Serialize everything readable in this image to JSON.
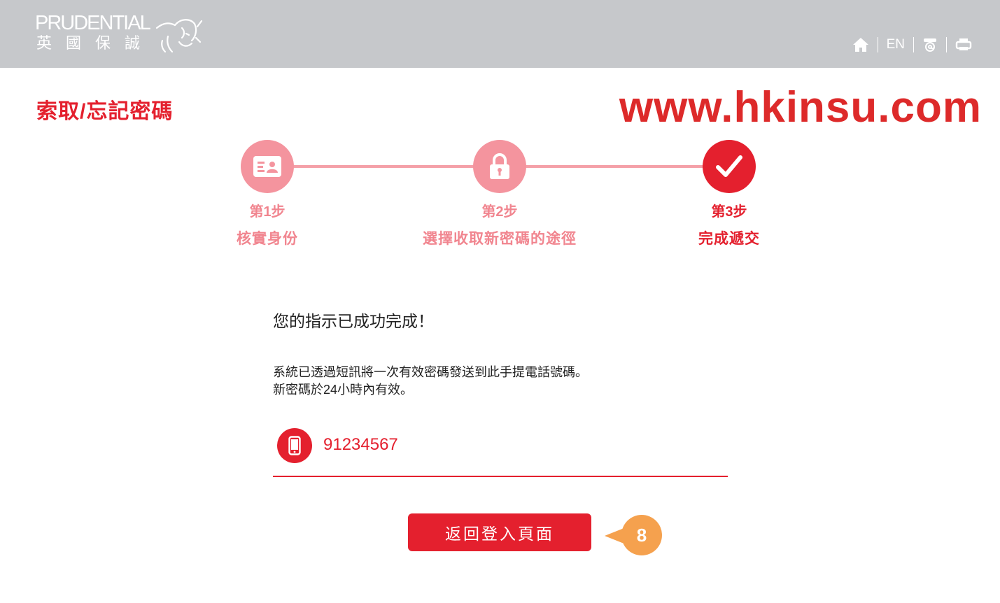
{
  "header": {
    "logo_en": "PRUDENTIAL",
    "logo_zh": "英國保誠",
    "utility": {
      "home_icon": "home-icon",
      "language": "EN",
      "contact_icon": "email-contact-icon",
      "print_icon": "print-icon"
    }
  },
  "page": {
    "title": "索取/忘記密碼",
    "watermark": "www.hkinsu.com"
  },
  "stepper": {
    "steps": [
      {
        "number": "第1步",
        "name": "核實身份",
        "icon": "id-card-icon",
        "state": "done"
      },
      {
        "number": "第2步",
        "name": "選擇收取新密碼的途徑",
        "icon": "lock-icon",
        "state": "done"
      },
      {
        "number": "第3步",
        "name": "完成遞交",
        "icon": "check-icon",
        "state": "active"
      }
    ]
  },
  "content": {
    "heading": "您的指示已成功完成！",
    "message_line1": "系統已透過短訊將一次有效密碼發送到此手提電話號碼。",
    "message_line2": "新密碼於24小時內有效。",
    "phone_icon": "mobile-phone-icon",
    "phone_number": "91234567"
  },
  "actions": {
    "back_to_login": "返回登入頁面",
    "callout_number": "8"
  },
  "colors": {
    "brand_red": "#e4202e",
    "step_pending": "#f4949e",
    "header_gray": "#c6c8cb",
    "callout_orange": "#f5a14e"
  }
}
